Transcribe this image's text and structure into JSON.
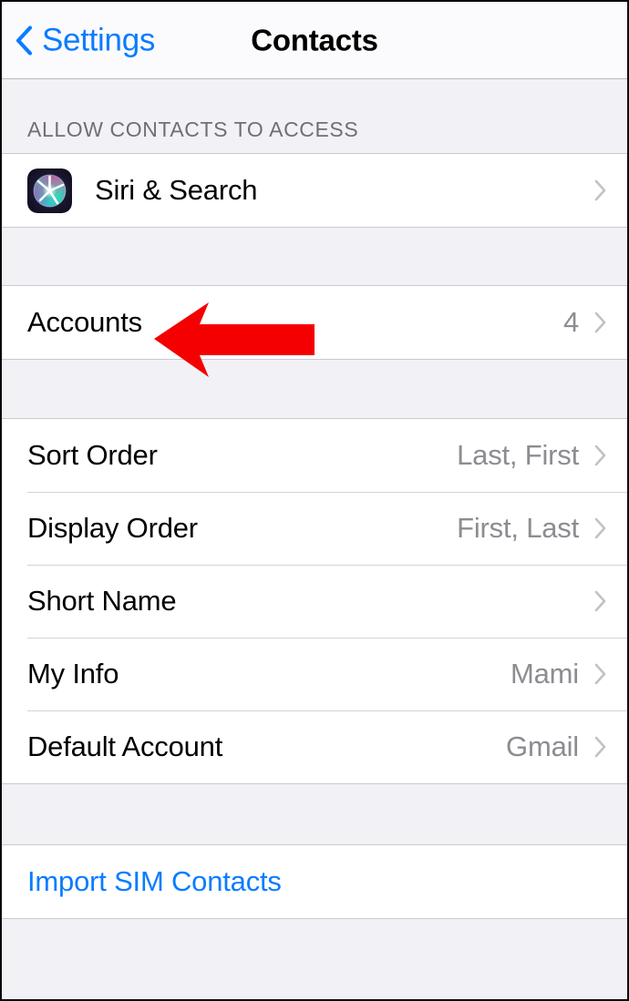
{
  "navbar": {
    "back_label": "Settings",
    "back_icon": "chevron-left-icon",
    "title": "Contacts"
  },
  "colors": {
    "accent_blue": "#0a7cff",
    "value_gray": "#8c8c92",
    "header_gray": "#6f6f75",
    "group_background": "#ffffff",
    "page_background": "#f2f1f6",
    "annotation_red": "#f50000"
  },
  "sections": [
    {
      "header": "ALLOW CONTACTS TO ACCESS",
      "rows": [
        {
          "label": "Siri & Search",
          "value": "",
          "icon": "siri-icon",
          "accessory": "chevron-right-icon"
        }
      ]
    },
    {
      "header": "",
      "rows": [
        {
          "label": "Accounts",
          "value": "4",
          "icon": "",
          "accessory": "chevron-right-icon"
        }
      ]
    },
    {
      "header": "",
      "rows": [
        {
          "label": "Sort Order",
          "value": "Last, First",
          "icon": "",
          "accessory": "chevron-right-icon"
        },
        {
          "label": "Display Order",
          "value": "First, Last",
          "icon": "",
          "accessory": "chevron-right-icon"
        },
        {
          "label": "Short Name",
          "value": "",
          "icon": "",
          "accessory": "chevron-right-icon"
        },
        {
          "label": "My Info",
          "value": "Mami",
          "icon": "",
          "accessory": "chevron-right-icon"
        },
        {
          "label": "Default Account",
          "value": "Gmail",
          "icon": "",
          "accessory": "chevron-right-icon"
        }
      ]
    },
    {
      "header": "",
      "rows": [
        {
          "label": "Import SIM Contacts",
          "value": "",
          "icon": "",
          "accessory": ""
        }
      ]
    }
  ],
  "annotation": {
    "shape": "arrow-left",
    "color": "#f50000",
    "points_at": "Accounts"
  }
}
